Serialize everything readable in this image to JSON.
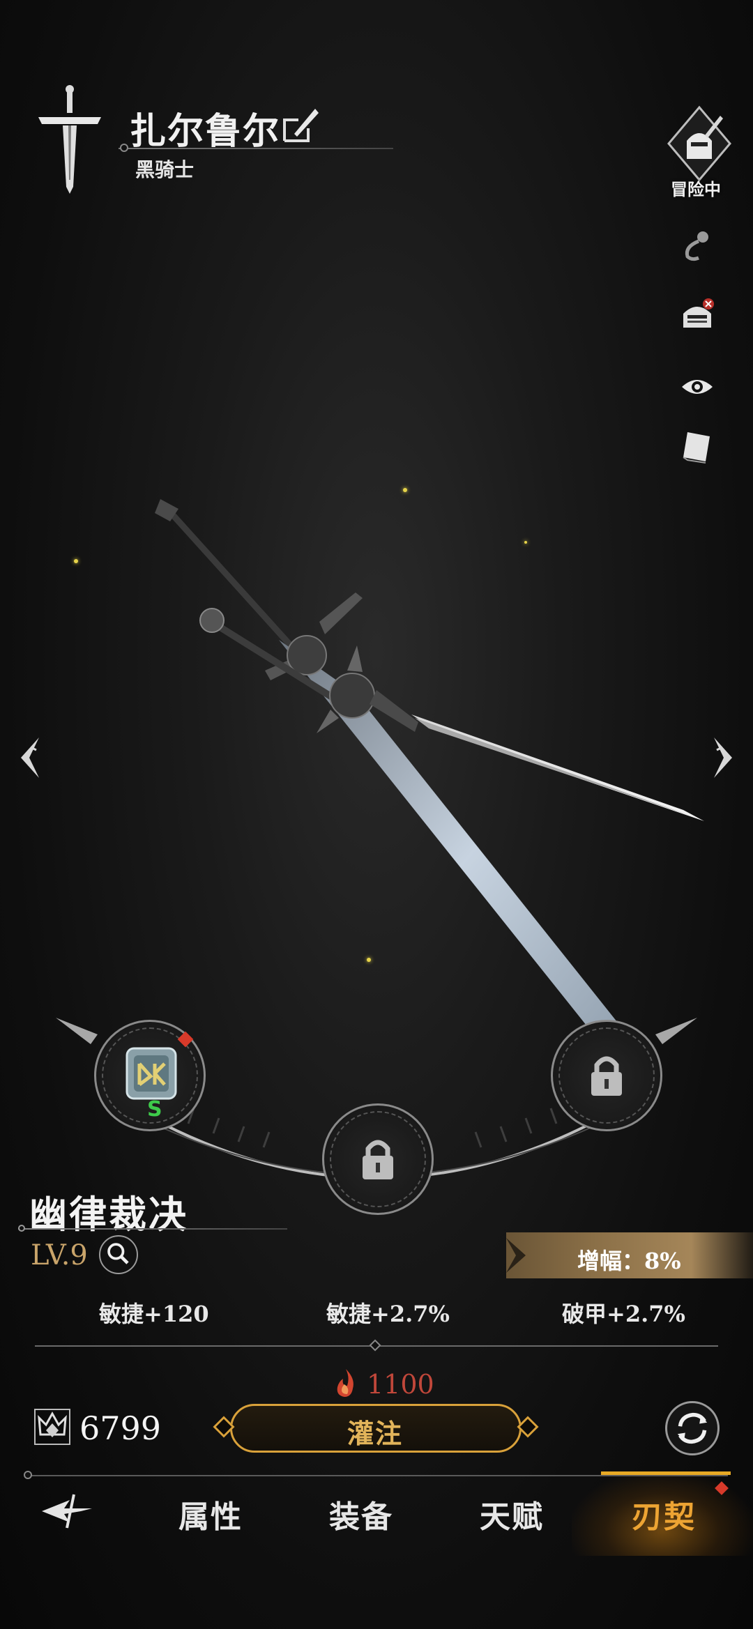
{
  "header": {
    "character_name": "扎尔鲁尔",
    "character_class": "黑骑士",
    "status_label": "冒险中"
  },
  "side_icons": [
    "hook-icon",
    "helmet-icon",
    "eye-icon",
    "card-icon"
  ],
  "weapon": {
    "name": "幽律裁决",
    "level": "LV.9",
    "amplify_label": "增幅：8%",
    "stats": [
      "敏捷+120",
      "敏捷+2.7%",
      "破甲+2.7%"
    ]
  },
  "slots": {
    "left": {
      "state": "rune",
      "grade": "S"
    },
    "center": {
      "state": "locked"
    },
    "right": {
      "state": "locked"
    }
  },
  "action": {
    "cost": "1100",
    "currency_amount": "6799",
    "infuse_label": "灌注"
  },
  "nav": {
    "tabs": [
      "属性",
      "装备",
      "天赋",
      "刃契"
    ],
    "active_tab": "刃契"
  },
  "colors": {
    "accent_gold": "#d9a13a",
    "active_tab": "#eda433",
    "cost_red": "#c0473a",
    "grade_green": "#3ecb4b",
    "alert_red": "#d83a2a"
  }
}
